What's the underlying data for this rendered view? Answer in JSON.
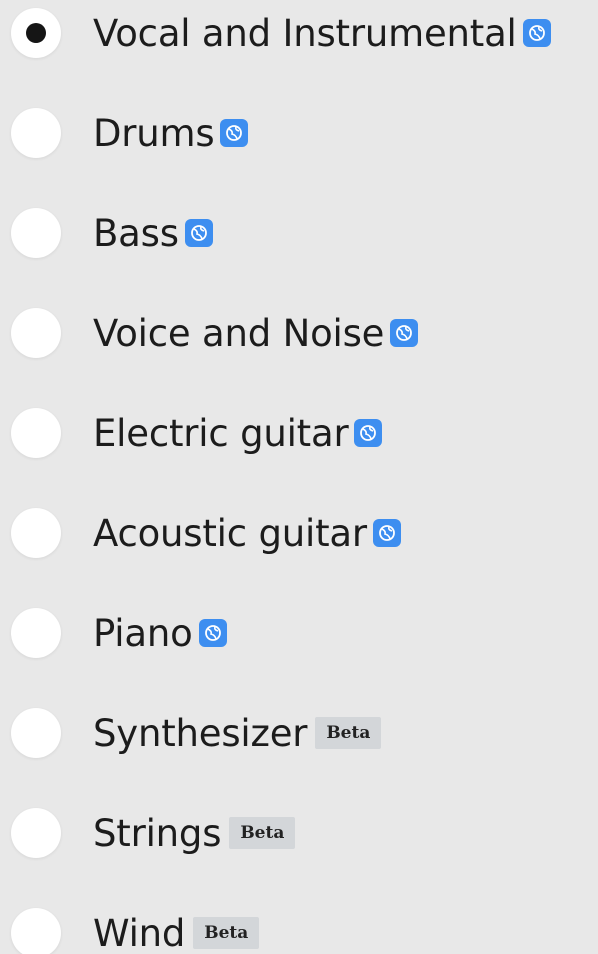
{
  "options": [
    {
      "label": "Vocal and Instrumental",
      "selected": true,
      "badge": "icon"
    },
    {
      "label": "Drums",
      "selected": false,
      "badge": "icon"
    },
    {
      "label": "Bass",
      "selected": false,
      "badge": "icon"
    },
    {
      "label": "Voice and Noise",
      "selected": false,
      "badge": "icon"
    },
    {
      "label": "Electric guitar",
      "selected": false,
      "badge": "icon"
    },
    {
      "label": "Acoustic guitar",
      "selected": false,
      "badge": "icon"
    },
    {
      "label": "Piano",
      "selected": false,
      "badge": "icon"
    },
    {
      "label": "Synthesizer",
      "selected": false,
      "badge": "beta"
    },
    {
      "label": "Strings",
      "selected": false,
      "badge": "beta"
    },
    {
      "label": "Wind",
      "selected": false,
      "badge": "beta"
    }
  ],
  "beta_label": "Beta",
  "badge_icon_name": "globe-badge-icon",
  "colors": {
    "badge_icon_bg": "#3d8ef0",
    "beta_bg": "#d3d6d9",
    "selected_dot": "#151515"
  }
}
